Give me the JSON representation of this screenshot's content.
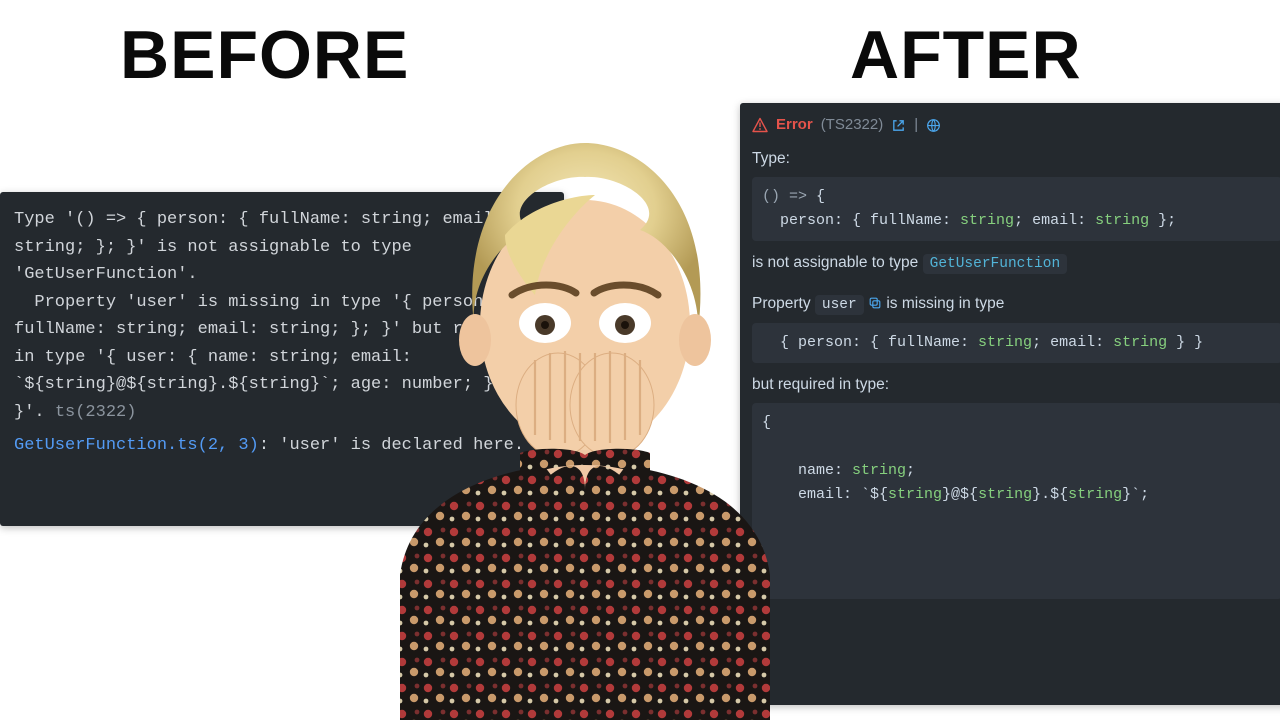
{
  "headings": {
    "before": "BEFORE",
    "after": "AFTER"
  },
  "before_panel": {
    "line1": "Type '() => { person: { fullName: string; email:",
    "line2": "string; }; }' is not assignable to type",
    "line3": "'GetUserFunction'.",
    "line4": "  Property 'user' is missing in type '{ person: {",
    "line5": "fullName: string; email: string; }; }' but required",
    "line6": "in type '{ user: { name: string; email:",
    "line7": "`${string}@${string}.${string}`; age: number; };",
    "line8pre": "}'.",
    "line8code": "ts(2322)",
    "location_link": "GetUserFunction.ts(2, 3)",
    "location_rest": ": 'user' is declared here."
  },
  "after_panel": {
    "error_label": "Error",
    "error_code": "(TS2322)",
    "divider": " | ",
    "line_type": "Type:",
    "type_box_line1_prefix": "() => ",
    "type_box_line1_brace": "{",
    "type_box_line2_a": "  person: ",
    "type_box_line2_b": "{ fullName: ",
    "type_box_line2_c": "; email: ",
    "type_box_line2_d": " };",
    "string_kw": "string",
    "assignable": "is not assignable to type",
    "target_type": "GetUserFunction",
    "prop_line_a": "Property",
    "prop_user": "user",
    "prop_line_b": "is missing in type",
    "missing_type_box": "  { person: { fullName: string; email: string } }",
    "but_required": "but required in type:",
    "req_box_l1": "{",
    "req_box_l2": "    name: string;",
    "req_box_l3_pre": "    email: `${",
    "req_box_l3_mid": "string",
    "req_box_l3_rest": "}@${string}.${string}`;"
  },
  "colors": {
    "panel_bg": "#24292e",
    "code_bg": "#2d333b",
    "error_red": "#e5534b",
    "action_blue": "#4ba7ee",
    "type_cyan": "#52b4d8",
    "string_green": "#86d07e",
    "link_blue": "#539bf5"
  }
}
